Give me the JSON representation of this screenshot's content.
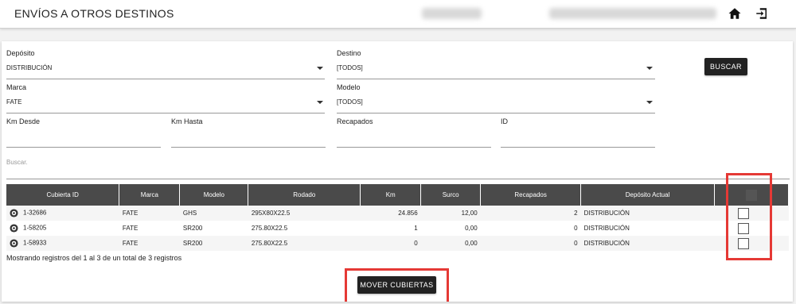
{
  "header": {
    "title": "ENVÍOS A OTROS DESTINOS",
    "home_icon": "home-icon",
    "exit_icon": "logout-icon"
  },
  "filters": {
    "deposito": {
      "label": "Depósito",
      "value": "DISTRIBUCIÓN"
    },
    "destino": {
      "label": "Destino",
      "value": "[TODOS]"
    },
    "marca": {
      "label": "Marca",
      "value": "FATE"
    },
    "modelo": {
      "label": "Modelo",
      "value": "[TODOS]"
    },
    "km_desde": {
      "label": "Km Desde",
      "value": ""
    },
    "km_hasta": {
      "label": "Km Hasta",
      "value": ""
    },
    "recapados": {
      "label": "Recapados",
      "value": ""
    },
    "id": {
      "label": "ID",
      "value": ""
    },
    "buscar_button": "BUSCAR"
  },
  "search": {
    "placeholder": "Buscar."
  },
  "table": {
    "columns": [
      "Cubierta ID",
      "Marca",
      "Modelo",
      "Rodado",
      "Km",
      "Surco",
      "Recapados",
      "Depósito Actual",
      ""
    ],
    "rows": [
      {
        "id": "1-32686",
        "marca": "FATE",
        "modelo": "GHS",
        "rodado": "295X80X22.5",
        "km": "24.856",
        "surco": "12,00",
        "recapados": "2",
        "deposito": "DISTRIBUCIÓN",
        "checked": false
      },
      {
        "id": "1-58205",
        "marca": "FATE",
        "modelo": "SR200",
        "rodado": "275.80X22.5",
        "km": "1",
        "surco": "0,00",
        "recapados": "0",
        "deposito": "DISTRIBUCIÓN",
        "checked": false
      },
      {
        "id": "1-58933",
        "marca": "FATE",
        "modelo": "SR200",
        "rodado": "275.80X22.5",
        "km": "0",
        "surco": "0,00",
        "recapados": "0",
        "deposito": "DISTRIBUCIÓN",
        "checked": false
      }
    ],
    "row_icon": "tire-icon"
  },
  "footer": {
    "records_text": "Mostrando registros del 1 al 3 de un total de 3 registros",
    "move_button": "MOVER CUBIERTAS"
  },
  "colors": {
    "header_dark": "#4a4a4a",
    "button_dark": "#222222",
    "highlight_red": "#e53935"
  }
}
